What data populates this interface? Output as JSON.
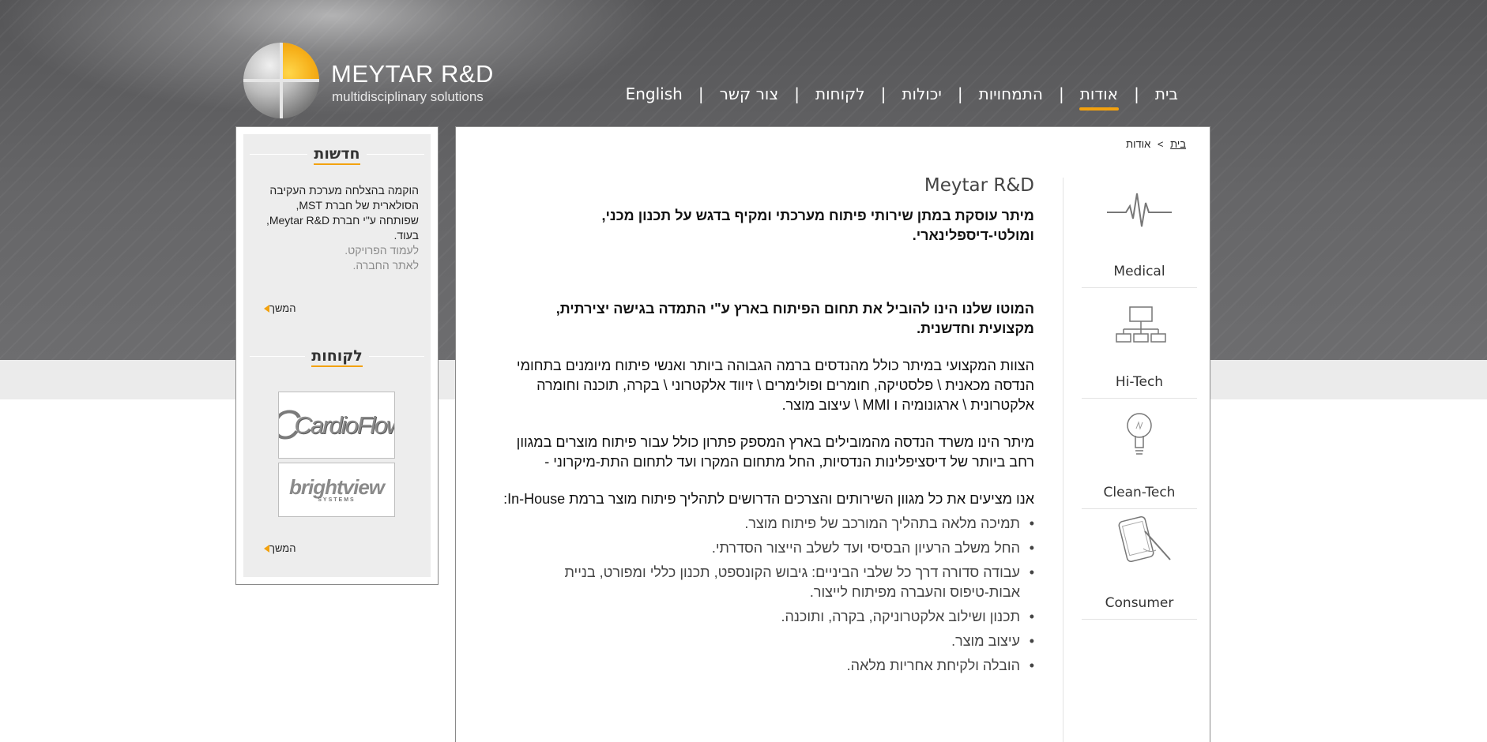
{
  "header": {
    "logo_name": "MEYTAR R&D",
    "logo_tagline": "multidisciplinary solutions",
    "nav": [
      {
        "label": "בית",
        "active": false
      },
      {
        "label": "אודות",
        "active": true
      },
      {
        "label": "התמחויות",
        "active": false
      },
      {
        "label": "יכולות",
        "active": false
      },
      {
        "label": "לקוחות",
        "active": false
      },
      {
        "label": "צור קשר",
        "active": false
      },
      {
        "label": "English",
        "active": false
      }
    ],
    "nav_separator": "|",
    "accent_color": "#f3a20f"
  },
  "sidebar": {
    "news": {
      "title": "חדשות",
      "text": "הוקמה בהצלחה מערכת העקיבה הסולארית של חברת MST, שפותחה ע\"י חברת Meytar R&D, בעוד.",
      "link_project": "לעמוד הפרויקט.",
      "link_company": "לאתר החברה.",
      "more_label": "המשך"
    },
    "clients": {
      "title": "לקוחות",
      "logos": [
        {
          "name": "CardioFlow",
          "icon": "cardioflow-logo"
        },
        {
          "name": "brightview",
          "sub": "SYSTEMS",
          "icon": "brightview-logo"
        }
      ],
      "more_label": "המשך"
    }
  },
  "breadcrumb": {
    "home": "בית",
    "separator": ">",
    "current": "אודות"
  },
  "categories": [
    {
      "label": "Medical",
      "icon": "heartbeat-icon"
    },
    {
      "label": "Hi-Tech",
      "icon": "network-icon"
    },
    {
      "label": "Clean-Tech",
      "icon": "lightbulb-icon"
    },
    {
      "label": "Consumer",
      "icon": "tablet-stylus-icon"
    }
  ],
  "main": {
    "title": "Meytar R&D",
    "intro": "מיתר עוסקת במתן שירותי פיתוח מערכתי ומקיף בדגש על תכנון מכני, ומולטי-דיספלינארי.",
    "motto": "המוטו שלנו הינו להוביל את תחום הפיתוח בארץ ע\"י התמדה בגישה יצירתית, מקצועית וחדשנית.",
    "team": "הצוות המקצועי במיתר כולל מהנדסים ברמה הגבוהה ביותר ואנשי פיתוח מיומנים בתחומי הנדסה מכאנית \\ פלסטיקה, חומרים ופולימרים \\ זיווד אלקטרוני \\ בקרה, תוכנה וחומרה אלקטרונית \\ ארגונומיה ו MMI \\ עיצוב מוצר.",
    "office": "מיתר הינו משרד הנדסה מהמובילים בארץ המספק פתרון כולל עבור פיתוח מוצרים במגוון רחב ביותר של דיסציפלינות הנדסיות, החל מתחום המקרו ועד לתחום התת-מיקרוני -",
    "offer": "אנו מציעים את כל מגוון השירותים והצרכים הדרושים לתהליך פיתוח מוצר ברמת In-House:",
    "bullets": [
      "תמיכה מלאה בתהליך המורכב של פיתוח מוצר.",
      "החל משלב הרעיון הבסיסי ועד לשלב הייצור הסדרתי.",
      "עבודה סדורה דרך כל שלבי הביניים: גיבוש הקונספט, תכנון כללי ומפורט, בניית אבות-טיפוס והעברה מפיתוח לייצור.",
      "תכנון ושילוב אלקטרוניקה, בקרה, ותוכנה.",
      "עיצוב מוצר.",
      "הובלה ולקיחת אחריות מלאה."
    ]
  }
}
